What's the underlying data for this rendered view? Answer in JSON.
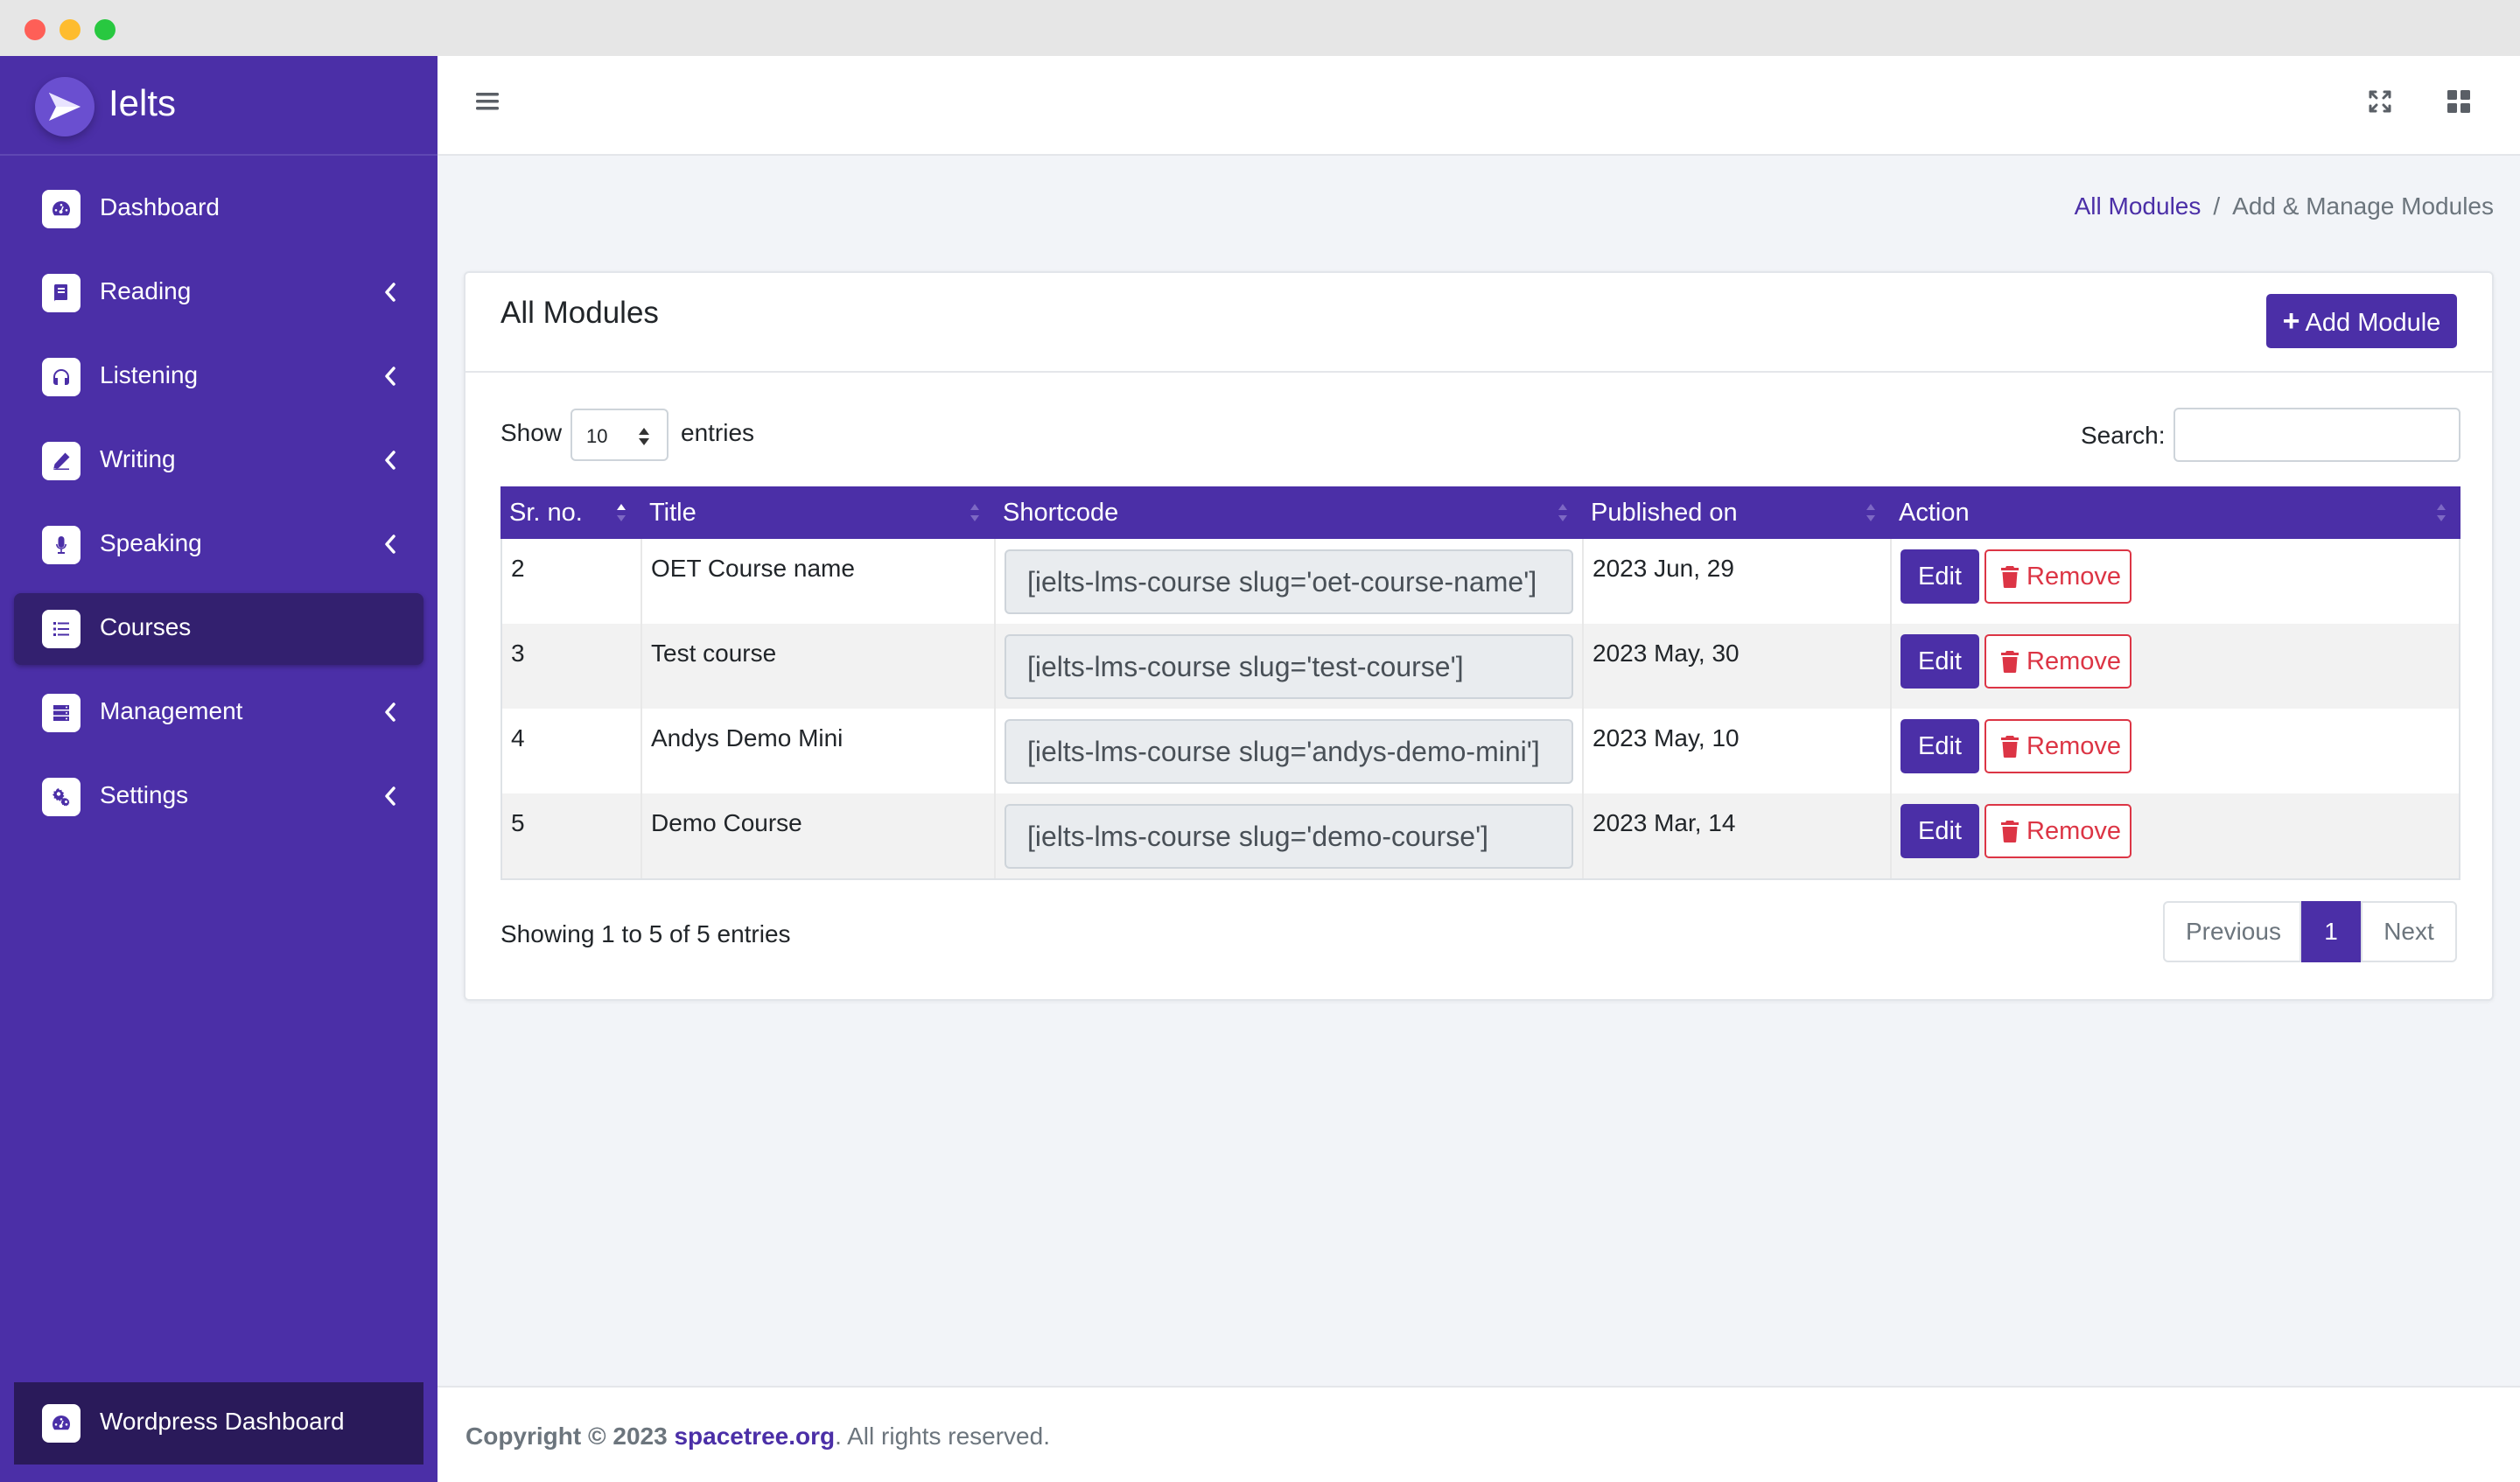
{
  "app": {
    "name": "Ielts"
  },
  "sidebar": {
    "items": [
      {
        "label": "Dashboard",
        "icon": "dashboard-icon",
        "has_submenu": false,
        "active": false
      },
      {
        "label": "Reading",
        "icon": "book-icon",
        "has_submenu": true,
        "active": false
      },
      {
        "label": "Listening",
        "icon": "headphones-icon",
        "has_submenu": true,
        "active": false
      },
      {
        "label": "Writing",
        "icon": "pencil-icon",
        "has_submenu": true,
        "active": false
      },
      {
        "label": "Speaking",
        "icon": "microphone-icon",
        "has_submenu": true,
        "active": false
      },
      {
        "label": "Courses",
        "icon": "list-icon",
        "has_submenu": false,
        "active": true
      },
      {
        "label": "Management",
        "icon": "server-icon",
        "has_submenu": true,
        "active": false
      },
      {
        "label": "Settings",
        "icon": "cogs-icon",
        "has_submenu": true,
        "active": false
      }
    ],
    "bottom_link": {
      "label": "Wordpress Dashboard",
      "icon": "dashboard-icon"
    }
  },
  "breadcrumb": {
    "link": "All Modules",
    "separator": "/",
    "current": "Add & Manage Modules"
  },
  "card": {
    "title": "All Modules",
    "add_button": "Add Module"
  },
  "table_controls": {
    "show_label": "Show",
    "page_length": "10",
    "entries_label": "entries",
    "search_label": "Search:",
    "search_value": ""
  },
  "table": {
    "headers": [
      "Sr. no.",
      "Title",
      "Shortcode",
      "Published on",
      "Action"
    ],
    "rows": [
      {
        "sr": "2",
        "title": "OET Course name",
        "shortcode": "[ielts-lms-course slug='oet-course-name']",
        "published": "2023 Jun, 29"
      },
      {
        "sr": "3",
        "title": "Test course",
        "shortcode": "[ielts-lms-course slug='test-course']",
        "published": "2023 May, 30"
      },
      {
        "sr": "4",
        "title": "Andys Demo Mini",
        "shortcode": "[ielts-lms-course slug='andys-demo-mini']",
        "published": "2023 May, 10"
      },
      {
        "sr": "5",
        "title": "Demo Course",
        "shortcode": "[ielts-lms-course slug='demo-course']",
        "published": "2023 Mar, 14"
      }
    ],
    "edit_label": "Edit",
    "remove_label": "Remove"
  },
  "pagination": {
    "info": "Showing 1 to 5 of 5 entries",
    "previous": "Previous",
    "current": "1",
    "next": "Next"
  },
  "footer": {
    "copyright": "Copyright © 2023",
    "site": "spacetree.org",
    "suffix": ". All rights reserved."
  },
  "colors": {
    "primary": "#4b2fa7",
    "danger": "#dc3545",
    "sidebar_active": "#33206f"
  }
}
